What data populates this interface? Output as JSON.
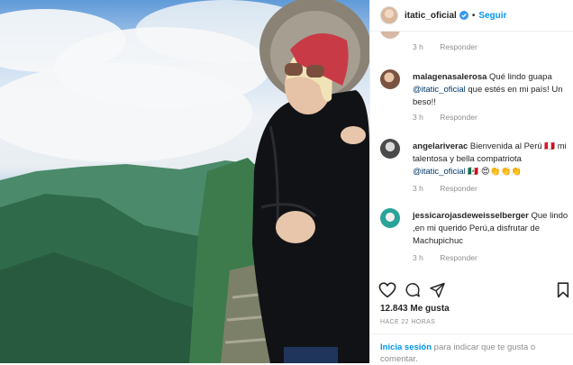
{
  "post": {
    "username": "itatic_oficial",
    "follow_label": "Seguir",
    "separator": "•"
  },
  "comments": [
    {
      "username": "",
      "text": "",
      "time": "3 h",
      "reply_label": "Responder",
      "avatar_color": "#d6b8a6"
    },
    {
      "username": "malagenasalerosa",
      "text": " Qué lindo guapa ",
      "mention": "@itatic_oficial",
      "text_after": " que estés en mi país! Un beso!!",
      "time": "3 h",
      "reply_label": "Responder",
      "avatar_color": "#b48a6e"
    },
    {
      "username": "angelariverac",
      "text": " Bienvenida al Perú 🇵🇪 mi talentosa y bella compatriota ",
      "mention": "@itatic_oficial",
      "text_after": " 🇲🇽 😍👏👏👏",
      "time": "3 h",
      "reply_label": "Responder",
      "avatar_color": "#6b6b6b"
    },
    {
      "username": "jessicarojasdeweisselberger",
      "text": " Que lindo ,en mi querido Perú,a disfrutar de Machupichuc",
      "time": "3 h",
      "reply_label": "Responder",
      "avatar_color": "#2aa39a"
    }
  ],
  "likes": "12.843 Me gusta",
  "timestamp": "HACE 22 HORAS",
  "login": {
    "link": "Inicia sesión",
    "text": " para indicar que te gusta o comentar."
  },
  "icons": {
    "like": "heart-icon",
    "comment": "comment-icon",
    "share": "share-icon",
    "save": "bookmark-icon",
    "verified": "verified-badge-icon"
  },
  "colors": {
    "link_blue": "#0095f6",
    "mention_blue": "#00376b",
    "verified": "#3897f0",
    "muted": "#8e8e8e"
  }
}
